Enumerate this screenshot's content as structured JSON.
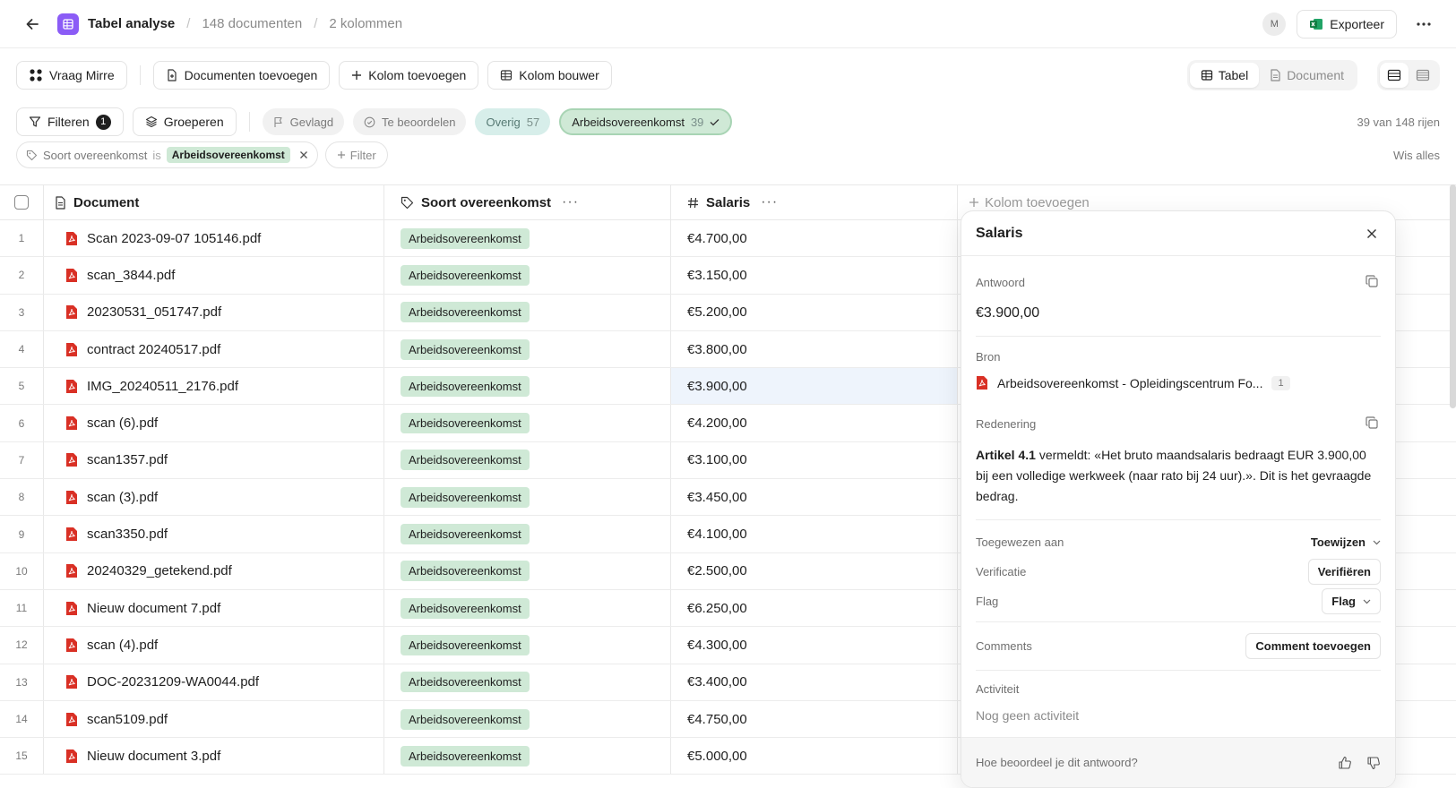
{
  "header": {
    "title": "Tabel analyse",
    "doc_count": "148 documenten",
    "col_count": "2 kolommen",
    "avatar": "M",
    "export_label": "Exporteer"
  },
  "toolbar": {
    "ask_label": "Vraag Mirre",
    "add_docs_label": "Documenten toevoegen",
    "add_col_label": "Kolom toevoegen",
    "col_builder_label": "Kolom bouwer",
    "view_table": "Tabel",
    "view_document": "Document"
  },
  "filters": {
    "filter_label": "Filteren",
    "filter_count": "1",
    "group_label": "Groeperen",
    "flagged_label": "Gevlagd",
    "review_label": "Te beoordelen",
    "other_label": "Overig",
    "other_count": "57",
    "contract_label": "Arbeidsovereenkomst",
    "contract_count": "39",
    "row_count": "39 van 148 rijen",
    "chip_field": "Soort overeenkomst",
    "chip_op": "is",
    "chip_value": "Arbeidsovereenkomst",
    "add_filter": "Filter",
    "clear_all": "Wis alles"
  },
  "table": {
    "columns": {
      "document": "Document",
      "type": "Soort overeenkomst",
      "salary": "Salaris",
      "add": "Kolom toevoegen"
    },
    "rows": [
      {
        "n": "1",
        "doc": "Scan 2023-09-07 105146.pdf",
        "type": "Arbeidsovereenkomst",
        "salary": "€4.700,00"
      },
      {
        "n": "2",
        "doc": "scan_3844.pdf",
        "type": "Arbeidsovereenkomst",
        "salary": "€3.150,00"
      },
      {
        "n": "3",
        "doc": "20230531_051747.pdf",
        "type": "Arbeidsovereenkomst",
        "salary": "€5.200,00"
      },
      {
        "n": "4",
        "doc": "contract 20240517.pdf",
        "type": "Arbeidsovereenkomst",
        "salary": "€3.800,00"
      },
      {
        "n": "5",
        "doc": "IMG_20240511_2176.pdf",
        "type": "Arbeidsovereenkomst",
        "salary": "€3.900,00"
      },
      {
        "n": "6",
        "doc": "scan (6).pdf",
        "type": "Arbeidsovereenkomst",
        "salary": "€4.200,00"
      },
      {
        "n": "7",
        "doc": "scan1357.pdf",
        "type": "Arbeidsovereenkomst",
        "salary": "€3.100,00"
      },
      {
        "n": "8",
        "doc": "scan (3).pdf",
        "type": "Arbeidsovereenkomst",
        "salary": "€3.450,00"
      },
      {
        "n": "9",
        "doc": "scan3350.pdf",
        "type": "Arbeidsovereenkomst",
        "salary": "€4.100,00"
      },
      {
        "n": "10",
        "doc": "20240329_getekend.pdf",
        "type": "Arbeidsovereenkomst",
        "salary": "€2.500,00"
      },
      {
        "n": "11",
        "doc": "Nieuw document 7.pdf",
        "type": "Arbeidsovereenkomst",
        "salary": "€6.250,00"
      },
      {
        "n": "12",
        "doc": "scan (4).pdf",
        "type": "Arbeidsovereenkomst",
        "salary": "€4.300,00"
      },
      {
        "n": "13",
        "doc": "DOC-20231209-WA0044.pdf",
        "type": "Arbeidsovereenkomst",
        "salary": "€3.400,00"
      },
      {
        "n": "14",
        "doc": "scan5109.pdf",
        "type": "Arbeidsovereenkomst",
        "salary": "€4.750,00"
      },
      {
        "n": "15",
        "doc": "Nieuw document 3.pdf",
        "type": "Arbeidsovereenkomst",
        "salary": "€5.000,00"
      }
    ]
  },
  "panel": {
    "title": "Salaris",
    "answer_label": "Antwoord",
    "answer_value": "€3.900,00",
    "source_label": "Bron",
    "source_name": "Arbeidsovereenkomst - Opleidingscentrum Fo...",
    "source_page": "1",
    "reasoning_label": "Redenering",
    "reasoning_bold": "Artikel 4.1",
    "reasoning_text": " vermeldt: «Het bruto maandsalaris bedraagt EUR 3.900,00 bij een volledige werkweek (naar rato bij 24 uur).». Dit is het gevraagde bedrag.",
    "assigned_label": "Toegewezen aan",
    "assign_value": "Toewijzen",
    "verification_label": "Verificatie",
    "verify_button": "Verifiëren",
    "flag_label": "Flag",
    "flag_button": "Flag",
    "comments_label": "Comments",
    "comment_button": "Comment toevoegen",
    "activity_label": "Activiteit",
    "activity_empty": "Nog geen activiteit",
    "feedback_question": "Hoe beoordeel je dit antwoord?"
  },
  "colors": {
    "accent_purple": "#8b5cf6",
    "tag_green": "#cfe9d6",
    "pill_teal": "#d7eeea",
    "pdf_red": "#d93025",
    "highlight_blue": "#eef4fc"
  }
}
